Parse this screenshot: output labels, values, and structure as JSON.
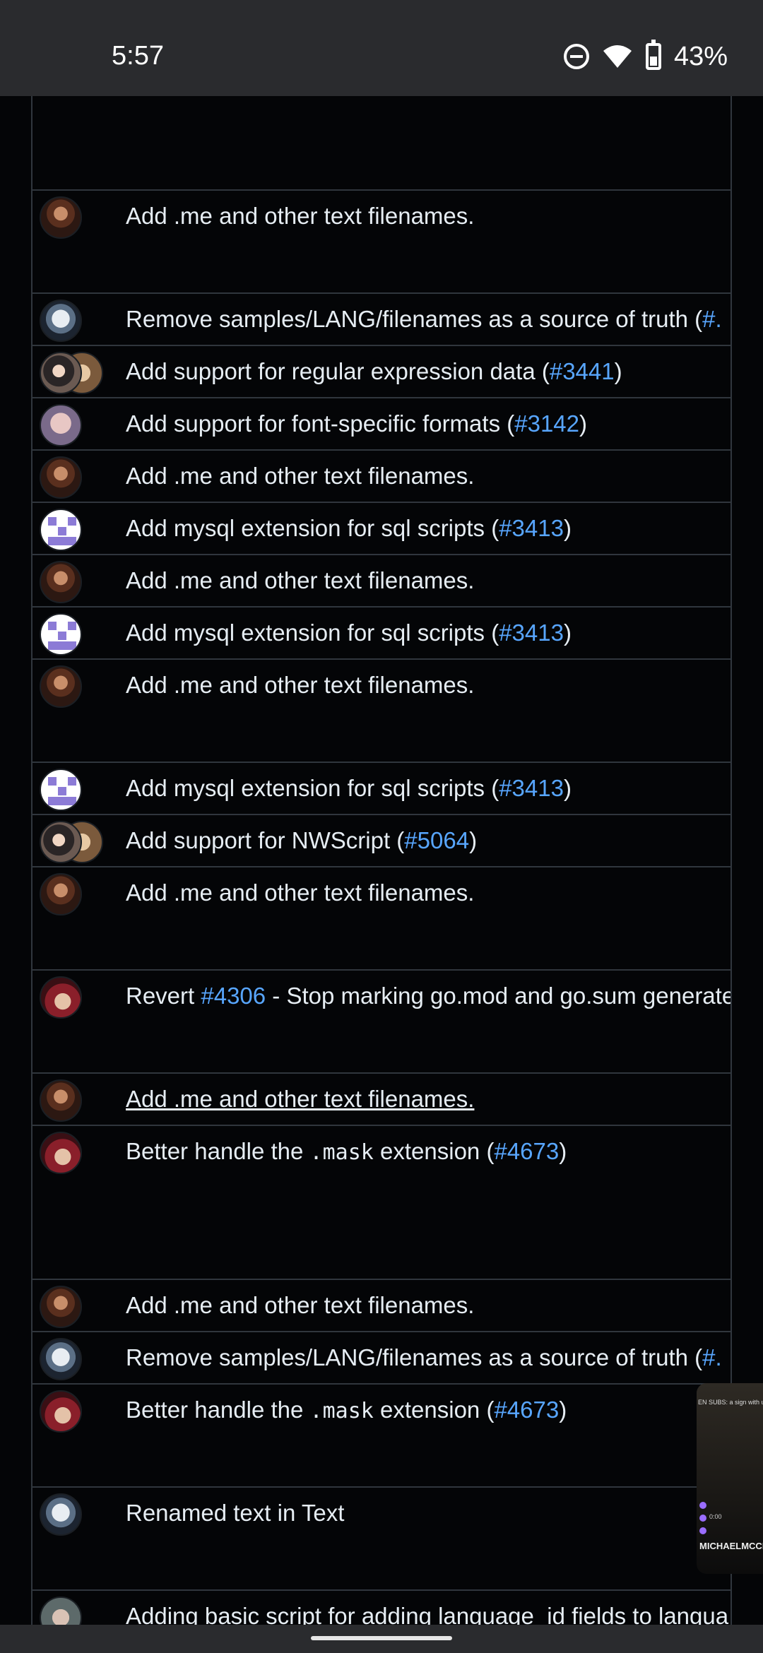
{
  "status_bar": {
    "time": "5:57",
    "battery_percent": "43%",
    "icons": [
      "do-not-disturb-icon",
      "wifi-icon",
      "battery-icon"
    ]
  },
  "colors": {
    "background": "#040507",
    "border": "#30363d",
    "text": "#e6edf3",
    "link": "#58a6ff",
    "status_bar": "#2a2b2e"
  },
  "commits": [
    {
      "avatar": "brown",
      "parts": [
        {
          "t": "Add .me and other text filenames."
        }
      ]
    },
    {
      "avatar": "robot",
      "parts": [
        {
          "t": "Remove samples/LANG/filenames as a source of truth ("
        },
        {
          "t": "#.",
          "link": true
        }
      ]
    },
    {
      "avatar": "girl-pair",
      "parts": [
        {
          "t": "Add support for regular expression data ("
        },
        {
          "t": "#3441",
          "link": true
        },
        {
          "t": ")"
        }
      ]
    },
    {
      "avatar": "bald",
      "parts": [
        {
          "t": "Add support for font-specific formats ("
        },
        {
          "t": "#3142",
          "link": true
        },
        {
          "t": ")"
        }
      ]
    },
    {
      "avatar": "brown",
      "parts": [
        {
          "t": "Add .me and other text filenames."
        }
      ]
    },
    {
      "avatar": "purple",
      "parts": [
        {
          "t": "Add mysql extension for sql scripts ("
        },
        {
          "t": "#3413",
          "link": true
        },
        {
          "t": ")"
        }
      ]
    },
    {
      "avatar": "brown",
      "parts": [
        {
          "t": "Add .me and other text filenames."
        }
      ]
    },
    {
      "avatar": "purple",
      "parts": [
        {
          "t": "Add mysql extension for sql scripts ("
        },
        {
          "t": "#3413",
          "link": true
        },
        {
          "t": ")"
        }
      ]
    },
    {
      "avatar": "brown",
      "parts": [
        {
          "t": "Add .me and other text filenames."
        }
      ]
    },
    {
      "avatar": "purple",
      "parts": [
        {
          "t": "Add mysql extension for sql scripts ("
        },
        {
          "t": "#3413",
          "link": true
        },
        {
          "t": ")"
        }
      ]
    },
    {
      "avatar": "girl-pair",
      "parts": [
        {
          "t": "Add support for NWScript ("
        },
        {
          "t": "#5064",
          "link": true
        },
        {
          "t": ")"
        }
      ]
    },
    {
      "avatar": "brown",
      "parts": [
        {
          "t": "Add .me and other text filenames."
        }
      ]
    },
    {
      "avatar": "red",
      "parts": [
        {
          "t": "Revert "
        },
        {
          "t": "#4306",
          "link": true
        },
        {
          "t": " - Stop marking go.mod and go.sum generate"
        }
      ]
    },
    {
      "avatar": "brown",
      "underlined": true,
      "parts": [
        {
          "t": "Add .me and other text filenames."
        }
      ]
    },
    {
      "avatar": "red",
      "parts": [
        {
          "t": "Better handle the "
        },
        {
          "t": ".mask",
          "code": true
        },
        {
          "t": " extension ("
        },
        {
          "t": "#4673",
          "link": true
        },
        {
          "t": ")"
        }
      ]
    },
    {
      "avatar": "brown",
      "parts": [
        {
          "t": "Add .me and other text filenames."
        }
      ]
    },
    {
      "avatar": "robot",
      "parts": [
        {
          "t": "Remove samples/LANG/filenames as a source of truth ("
        },
        {
          "t": "#.",
          "link": true
        }
      ]
    },
    {
      "avatar": "red",
      "parts": [
        {
          "t": "Better handle the "
        },
        {
          "t": ".mask",
          "code": true
        },
        {
          "t": " extension ("
        },
        {
          "t": "#4673",
          "link": true
        },
        {
          "t": ")"
        }
      ]
    },
    {
      "avatar": "robot",
      "parts": [
        {
          "t": "Renamed text in Text"
        }
      ]
    },
    {
      "avatar": "glasses",
      "parts": [
        {
          "t": "Adding basic script for adding language_id fields to langua"
        }
      ]
    }
  ],
  "pip": {
    "caption": "EN SUBS: a sign with ur n",
    "name": "MICHAELMCCHILL",
    "counter": "0:00"
  }
}
